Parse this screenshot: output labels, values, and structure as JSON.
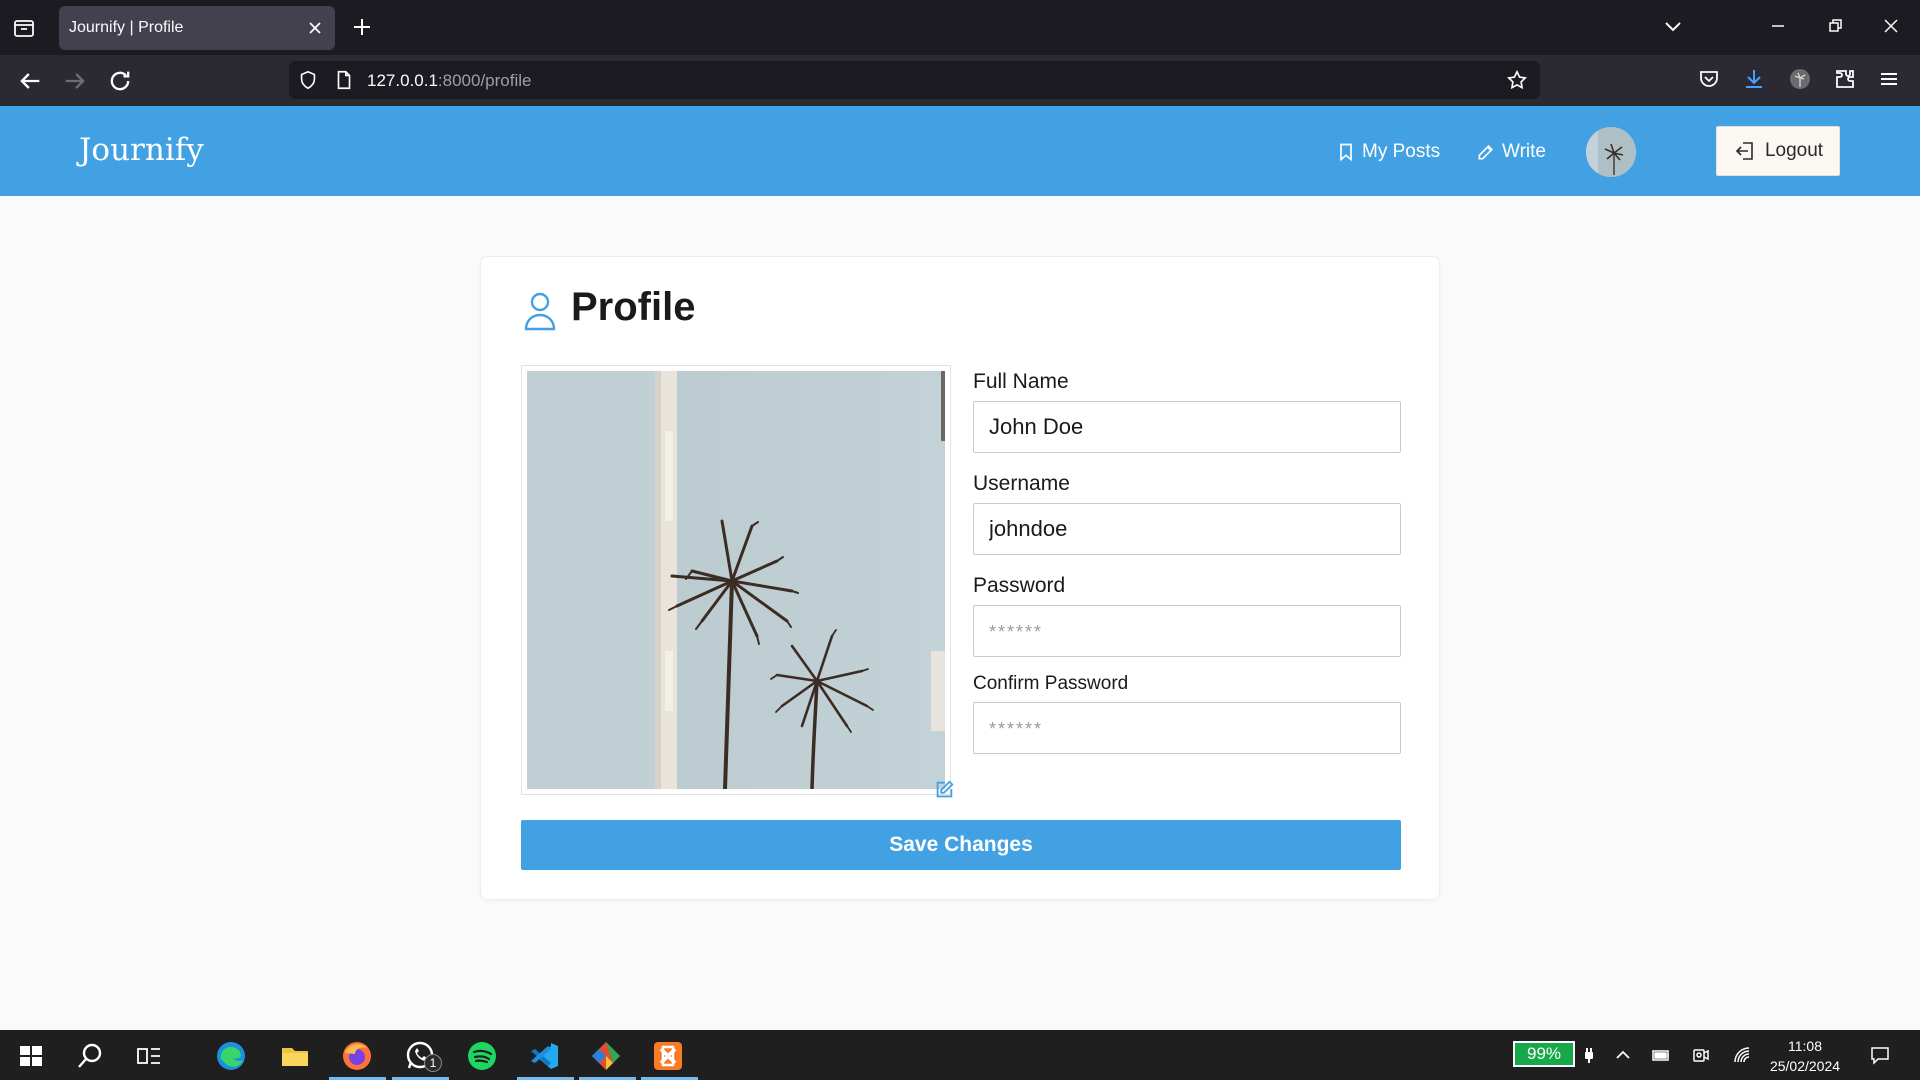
{
  "browser": {
    "tab_title": "Journify | Profile",
    "url_host": "127.0.0.1",
    "url_path": ":8000/profile"
  },
  "header": {
    "brand": "Journify",
    "my_posts_label": "My Posts",
    "write_label": "Write",
    "logout_label": "Logout",
    "accent_color": "#42a1e2"
  },
  "profile": {
    "title": "Profile",
    "full_name_label": "Full Name",
    "full_name_value": "John Doe",
    "username_label": "Username",
    "username_value": "johndoe",
    "password_label": "Password",
    "password_placeholder": "******",
    "confirm_password_label": "Confirm Password",
    "confirm_password_placeholder": "******",
    "save_label": "Save Changes"
  },
  "taskbar": {
    "battery": "99%",
    "time": "11:08",
    "date": "25/02/2024",
    "whatsapp_badge": "1"
  }
}
